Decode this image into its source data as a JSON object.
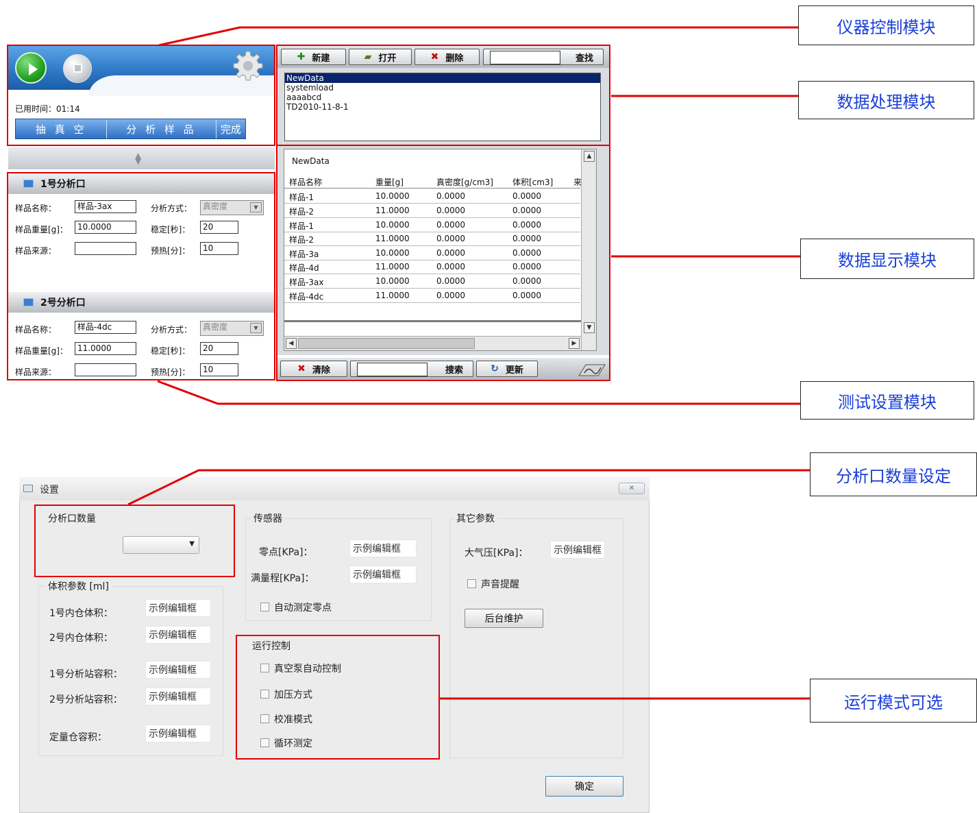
{
  "control": {
    "elapsed_label": "已用时间：",
    "elapsed_value": "01:14",
    "steps": [
      "抽 真 空",
      "分 析 样 品",
      "完成"
    ]
  },
  "ports": [
    {
      "title": "1号分析口",
      "name_label": "样品名称：",
      "name_value": "样品-3ax",
      "weight_label": "样品重量[g]：",
      "weight_value": "10.0000",
      "source_label": "样品来源：",
      "source_value": "",
      "method_label": "分析方式：",
      "method_value": "真密度",
      "stable_label": "稳定[秒]：",
      "stable_value": "20",
      "preheat_label": "预热[分]：",
      "preheat_value": "10"
    },
    {
      "title": "2号分析口",
      "name_label": "样品名称：",
      "name_value": "样品-4dc",
      "weight_label": "样品重量[g]：",
      "weight_value": "11.0000",
      "source_label": "样品来源：",
      "source_value": "",
      "method_label": "分析方式：",
      "method_value": "真密度",
      "stable_label": "稳定[秒]：",
      "stable_value": "20",
      "preheat_label": "预热[分]：",
      "preheat_value": "10"
    }
  ],
  "data_toolbar": {
    "new_label": "新建",
    "open_label": "打开",
    "delete_label": "删除",
    "search_value": "",
    "find_label": "查找"
  },
  "files": [
    "NewData",
    "systemload",
    "aaaabcd",
    "TD2010-11-8-1"
  ],
  "table": {
    "title": "NewData",
    "headers": [
      "样品名称",
      "重量[g]",
      "真密度[g/cm3]",
      "体积[cm3]",
      "来"
    ],
    "rows": [
      [
        "样品-1",
        "10.0000",
        "0.0000",
        "0.0000"
      ],
      [
        "样品-2",
        "11.0000",
        "0.0000",
        "0.0000"
      ],
      [
        "样品-1",
        "10.0000",
        "0.0000",
        "0.0000"
      ],
      [
        "样品-2",
        "11.0000",
        "0.0000",
        "0.0000"
      ],
      [
        "样品-3a",
        "10.0000",
        "0.0000",
        "0.0000"
      ],
      [
        "样品-4d",
        "11.0000",
        "0.0000",
        "0.0000"
      ],
      [
        "样品-3ax",
        "10.0000",
        "0.0000",
        "0.0000"
      ],
      [
        "样品-4dc",
        "11.0000",
        "0.0000",
        "0.0000"
      ]
    ]
  },
  "bottom_toolbar": {
    "clear_label": "清除",
    "search_value": "",
    "search_label": "搜索",
    "refresh_label": "更新"
  },
  "settings": {
    "title": "设置",
    "port_count": {
      "title": "分析口数量",
      "value": ""
    },
    "volume": {
      "title": "体积参数 [ml]",
      "items": [
        {
          "label": "1号内仓体积：",
          "value": "示例编辑框"
        },
        {
          "label": "2号内仓体积：",
          "value": "示例编辑框"
        },
        {
          "label": "1号分析站容积：",
          "value": "示例编辑框"
        },
        {
          "label": "2号分析站容积：",
          "value": "示例编辑框"
        },
        {
          "label": "定量仓容积：",
          "value": "示例编辑框"
        }
      ]
    },
    "sensor": {
      "title": "传感器",
      "zero_label": "零点[KPa]：",
      "zero_value": "示例编辑框",
      "range_label": "满量程[KPa]：",
      "range_value": "示例编辑框",
      "auto_zero_label": "自动测定零点"
    },
    "run": {
      "title": "运行控制",
      "options": [
        "真空泵自动控制",
        "加压方式",
        "校准模式",
        "循环测定"
      ]
    },
    "other": {
      "title": "其它参数",
      "atm_label": "大气压[KPa]：",
      "atm_value": "示例编辑框",
      "sound_label": "声音提醒",
      "maintenance_label": "后台维护"
    },
    "ok_label": "确定"
  },
  "callouts": {
    "instrument": "仪器控制模块",
    "data_proc": "数据处理模块",
    "data_disp": "数据显示模块",
    "test_set": "测试设置模块",
    "port_count": "分析口数量设定",
    "run_mode": "运行模式可选"
  },
  "colors": {
    "annotation": "#e00000",
    "callout_text": "#1a3fd6",
    "accent": "#2d76c3"
  }
}
